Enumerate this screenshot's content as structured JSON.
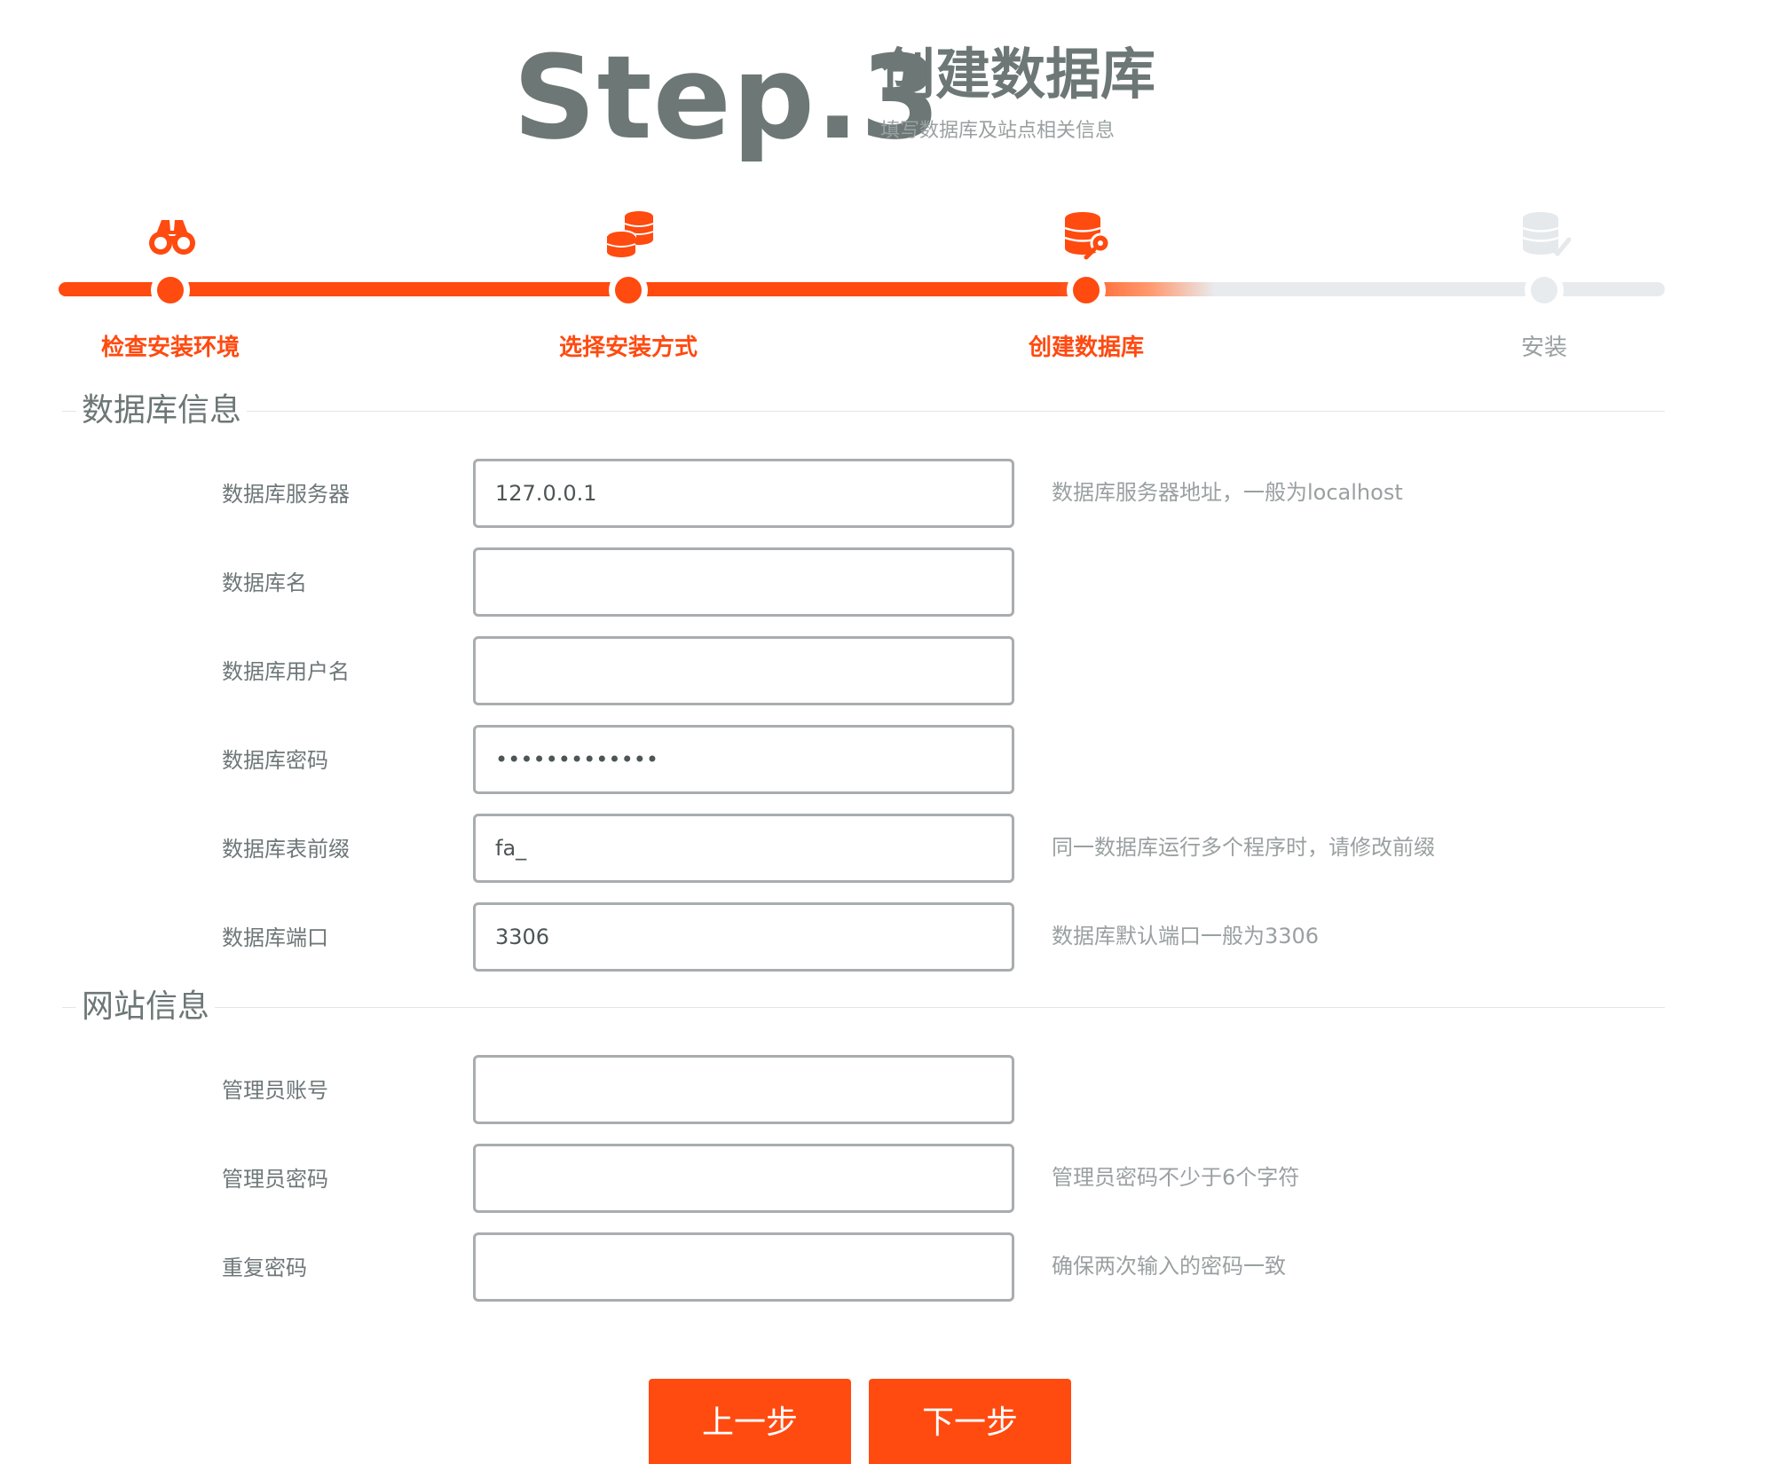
{
  "header": {
    "step": "Step.3",
    "title": "创建数据库",
    "subtitle": "填写数据库及站点相关信息"
  },
  "progress": {
    "steps": [
      {
        "label": "检查安装环境",
        "icon": "binoculars-icon",
        "state": "done"
      },
      {
        "label": "选择安装方式",
        "icon": "coins-icon",
        "state": "done"
      },
      {
        "label": "创建数据库",
        "icon": "database-key-icon",
        "state": "current"
      },
      {
        "label": "安装",
        "icon": "database-check-icon",
        "state": "pending"
      }
    ],
    "active_color": "#ff4a10",
    "inactive_color": "#e8ebee"
  },
  "sections": {
    "database": {
      "title": "数据库信息",
      "fields": [
        {
          "label": "数据库服务器",
          "value": "127.0.0.1",
          "hint": "数据库服务器地址，一般为localhost"
        },
        {
          "label": "数据库名",
          "value": "",
          "hint": ""
        },
        {
          "label": "数据库用户名",
          "value": "",
          "hint": ""
        },
        {
          "label": "数据库密码",
          "value": "•••••••••••••",
          "hint": ""
        },
        {
          "label": "数据库表前缀",
          "value": "fa_",
          "hint": "同一数据库运行多个程序时，请修改前缀"
        },
        {
          "label": "数据库端口",
          "value": "3306",
          "hint": "数据库默认端口一般为3306"
        }
      ]
    },
    "site": {
      "title": "网站信息",
      "fields": [
        {
          "label": "管理员账号",
          "value": "",
          "hint": ""
        },
        {
          "label": "管理员密码",
          "value": "",
          "hint": "管理员密码不少于6个字符"
        },
        {
          "label": "重复密码",
          "value": "",
          "hint": "确保两次输入的密码一致"
        }
      ]
    }
  },
  "buttons": {
    "prev": "上一步",
    "next": "下一步"
  }
}
